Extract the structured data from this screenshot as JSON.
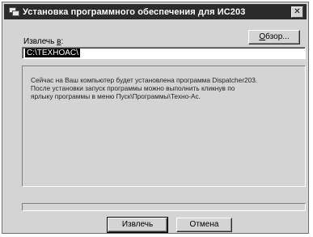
{
  "window": {
    "title": "Установка программного обеспечения для ИС203",
    "close_glyph": "✕"
  },
  "extract": {
    "label_pre": "Извлечь ",
    "label_accel": "в",
    "label_post": ":",
    "path": "C:\\TEXHOAC\\"
  },
  "browse": {
    "label_accel": "О",
    "label_rest": "бзор..."
  },
  "info": {
    "text": "Сейчас на Ваш компьютер будет установлена программа Dispatcher203.\nПосле установки запуск программы можно выполнить кликнув по\nярлыку программы в меню Пуск\\Программы\\Техно-Ас."
  },
  "progress": {
    "value": 0
  },
  "buttons": {
    "extract_label": "Извлечь",
    "cancel_label": "Отмена"
  }
}
